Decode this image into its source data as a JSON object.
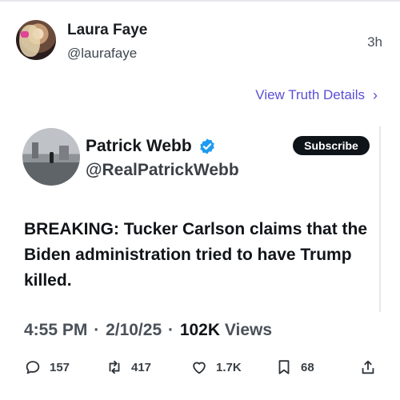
{
  "post": {
    "author_name": "Laura Faye",
    "author_handle": "@laurafaye",
    "time": "3h",
    "details_link": "View Truth Details",
    "details_chevron": "›"
  },
  "quoted": {
    "name": "Patrick Webb",
    "handle": "@RealPatrickWebb",
    "subscribe_label": "Subscribe",
    "text": "BREAKING: Tucker Carlson claims that the Biden administration tried to have Trump killed.",
    "time": "4:55 PM",
    "date": "2/10/25",
    "views_count": "102K",
    "views_label": "Views",
    "separator": "·"
  },
  "actions": {
    "replies": "157",
    "retweets": "417",
    "likes": "1.7K",
    "bookmarks": "68"
  },
  "colors": {
    "link": "#5a4fd6",
    "verified": "#1d9bf0",
    "subscribe_bg": "#0f1419"
  },
  "icons": [
    "reply-icon",
    "retweet-icon",
    "like-icon",
    "bookmark-icon",
    "share-icon",
    "verified-badge-icon",
    "chevron-right-icon"
  ]
}
